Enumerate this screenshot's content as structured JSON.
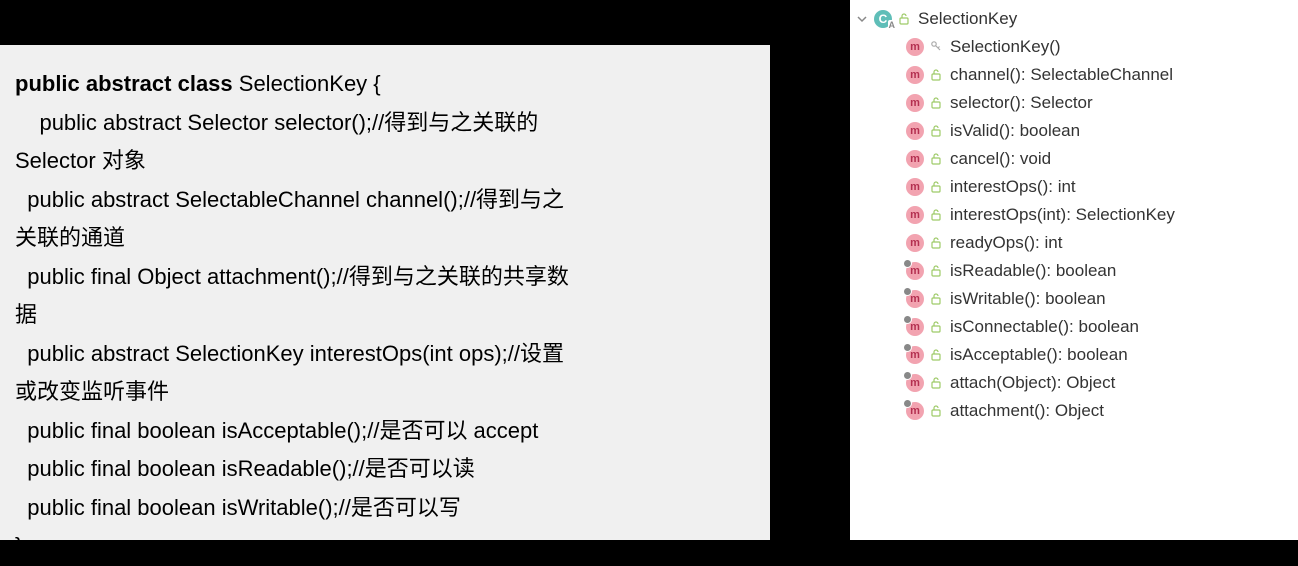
{
  "code": {
    "lines": [
      {
        "bold": "public abstract class ",
        "rest": "SelectionKey {"
      },
      {
        "indent": "    ",
        "text": "public abstract Selector selector();//得到与之关联的"
      },
      {
        "indent": "",
        "text": "Selector 对象"
      },
      {
        "indent": "  ",
        "text": "public abstract SelectableChannel channel();//得到与之"
      },
      {
        "indent": "",
        "text": "关联的通道"
      },
      {
        "indent": "  ",
        "text": "public final Object attachment();//得到与之关联的共享数"
      },
      {
        "indent": "",
        "text": "据"
      },
      {
        "indent": "  ",
        "text": "public abstract SelectionKey interestOps(int ops);//设置"
      },
      {
        "indent": "",
        "text": "或改变监听事件"
      },
      {
        "indent": "  ",
        "text": "public final boolean isAcceptable();//是否可以 accept"
      },
      {
        "indent": "  ",
        "text": "public final boolean isReadable();//是否可以读"
      },
      {
        "indent": "  ",
        "text": "public final boolean isWritable();//是否可以写"
      },
      {
        "indent": "",
        "text": "}"
      }
    ]
  },
  "structure": {
    "root": {
      "name": "SelectionKey",
      "classLetter": "C"
    },
    "members": [
      {
        "letter": "m",
        "access": "key",
        "final": false,
        "text": "SelectionKey()"
      },
      {
        "letter": "m",
        "access": "unlock",
        "final": false,
        "text": "channel(): SelectableChannel"
      },
      {
        "letter": "m",
        "access": "unlock",
        "final": false,
        "text": "selector(): Selector"
      },
      {
        "letter": "m",
        "access": "unlock",
        "final": false,
        "text": "isValid(): boolean"
      },
      {
        "letter": "m",
        "access": "unlock",
        "final": false,
        "text": "cancel(): void"
      },
      {
        "letter": "m",
        "access": "unlock",
        "final": false,
        "text": "interestOps(): int"
      },
      {
        "letter": "m",
        "access": "unlock",
        "final": false,
        "text": "interestOps(int): SelectionKey"
      },
      {
        "letter": "m",
        "access": "unlock",
        "final": false,
        "text": "readyOps(): int"
      },
      {
        "letter": "m",
        "access": "unlock",
        "final": true,
        "text": "isReadable(): boolean"
      },
      {
        "letter": "m",
        "access": "unlock",
        "final": true,
        "text": "isWritable(): boolean"
      },
      {
        "letter": "m",
        "access": "unlock",
        "final": true,
        "text": "isConnectable(): boolean"
      },
      {
        "letter": "m",
        "access": "unlock",
        "final": true,
        "text": "isAcceptable(): boolean"
      },
      {
        "letter": "m",
        "access": "unlock",
        "final": true,
        "text": "attach(Object): Object"
      },
      {
        "letter": "m",
        "access": "unlock",
        "final": true,
        "text": "attachment(): Object"
      }
    ]
  }
}
